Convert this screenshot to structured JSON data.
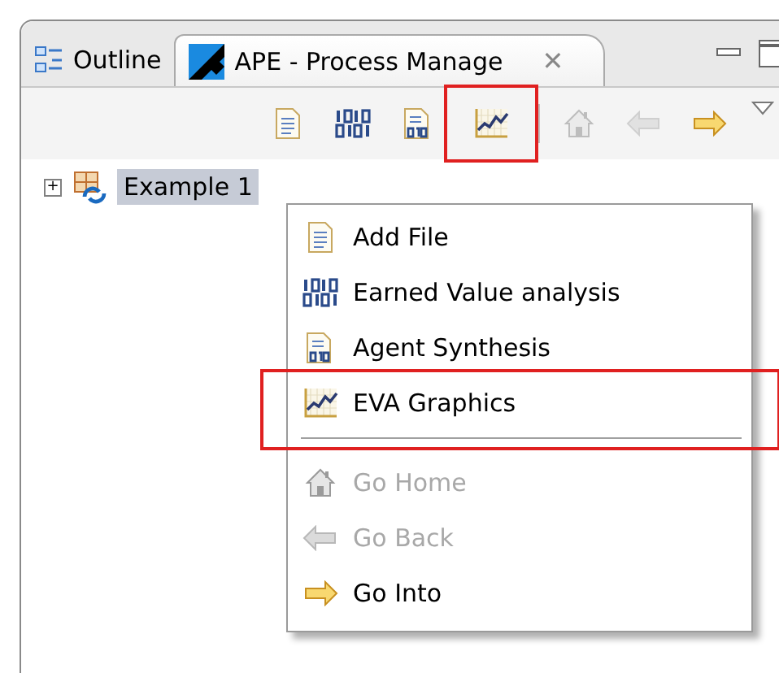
{
  "tabs": [
    {
      "label": "Outline",
      "selected": false
    },
    {
      "label": "APE - Process Manage",
      "selected": true,
      "close": "✕"
    }
  ],
  "toolbar": [
    {
      "kind": "button",
      "disabled": false,
      "highlighted": false
    },
    {
      "kind": "button",
      "disabled": false,
      "highlighted": false
    },
    {
      "kind": "button",
      "disabled": false,
      "highlighted": false
    },
    {
      "kind": "button",
      "disabled": false,
      "highlighted": true
    },
    {
      "kind": "separator"
    },
    {
      "kind": "button",
      "disabled": true,
      "highlighted": false
    },
    {
      "kind": "button",
      "disabled": true,
      "highlighted": false
    },
    {
      "kind": "button",
      "disabled": false,
      "highlighted": false
    }
  ],
  "tree": [
    {
      "label": "Example 1",
      "toggle": "+",
      "selected": true
    }
  ],
  "context_menu": [
    {
      "kind": "item",
      "label": "Add File",
      "disabled": false,
      "highlighted": false
    },
    {
      "kind": "item",
      "label": "Earned Value analysis",
      "disabled": false,
      "highlighted": false
    },
    {
      "kind": "item",
      "label": "Agent Synthesis",
      "disabled": false,
      "highlighted": false
    },
    {
      "kind": "item",
      "label": "EVA Graphics",
      "disabled": false,
      "highlighted": true
    },
    {
      "kind": "separator"
    },
    {
      "kind": "item",
      "label": "Go Home",
      "disabled": true,
      "highlighted": false
    },
    {
      "kind": "item",
      "label": "Go Back",
      "disabled": true,
      "highlighted": false
    },
    {
      "kind": "item",
      "label": "Go Into",
      "disabled": false,
      "highlighted": false
    }
  ]
}
